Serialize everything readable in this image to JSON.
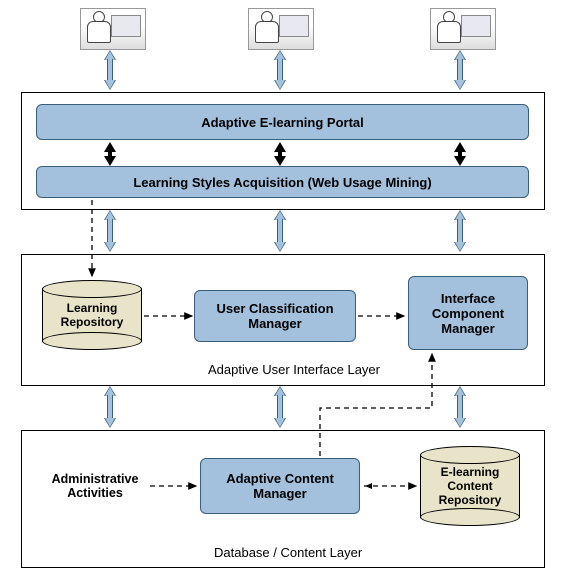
{
  "layers": {
    "portal": "Adaptive E-learning Portal",
    "lsa": "Learning Styles Acquisition (Web Usage Mining)",
    "learning_repo": "Learning\nRepository",
    "user_class_mgr": "User Classification\nManager",
    "interface_comp_mgr": "Interface\nComponent\nManager",
    "aui_layer": "Adaptive User Interface Layer",
    "admin_activities": "Administrative\nActivities",
    "adaptive_content_mgr": "Adaptive Content\nManager",
    "elearning_repo": "E-learning\nContent\nRepository",
    "db_layer": "Database / Content Layer"
  }
}
